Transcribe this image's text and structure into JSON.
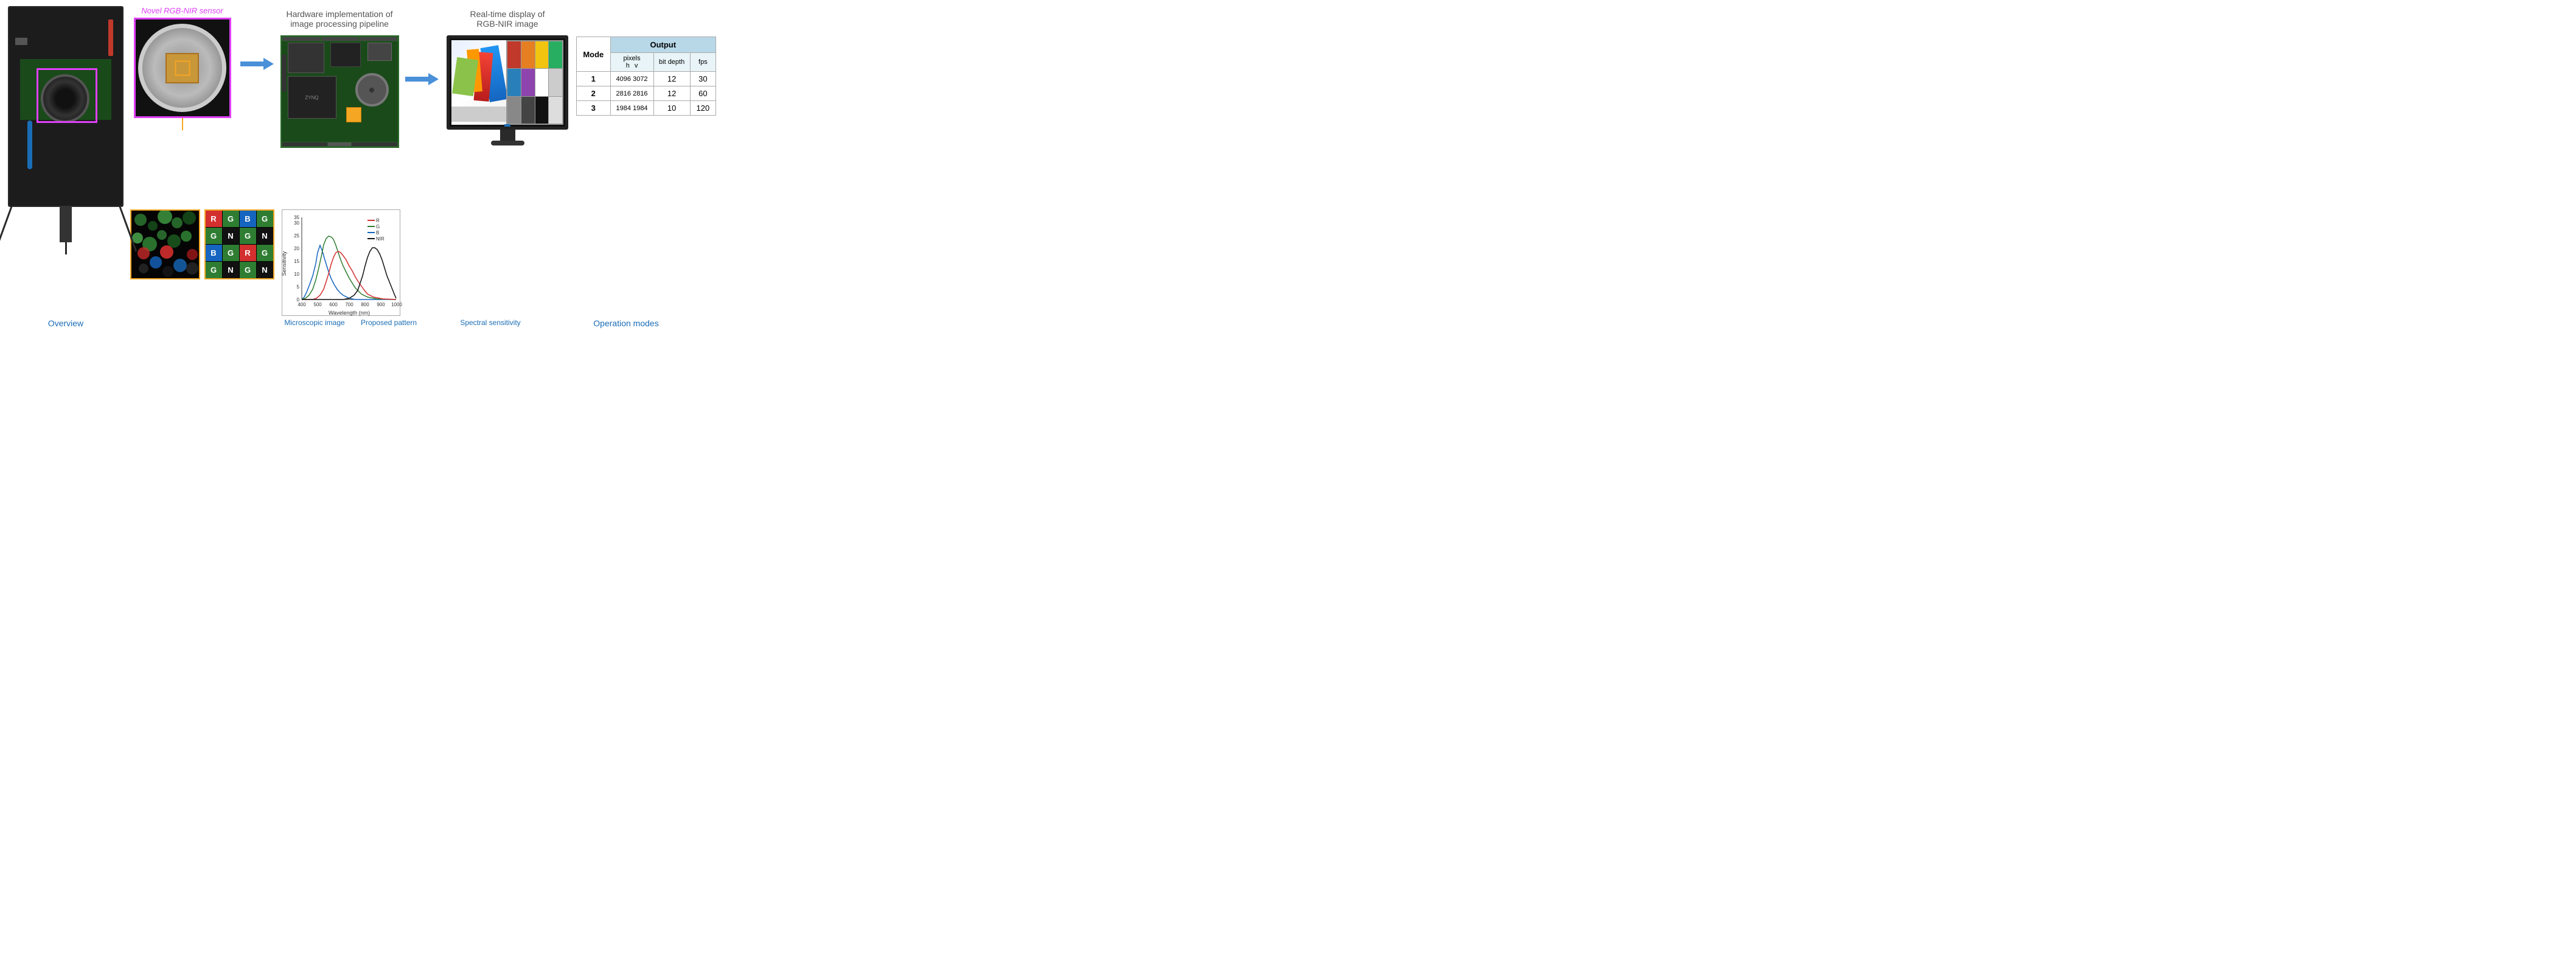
{
  "sections": {
    "overview": {
      "caption": "Overview"
    },
    "sensor": {
      "label": "Novel RGB-NIR sensor"
    },
    "hardware": {
      "title_line1": "Hardware implementation of",
      "title_line2": "image processing pipeline"
    },
    "realtime": {
      "title_line1": "Real-time display of",
      "title_line2": "RGB-NIR image"
    },
    "microscopic": {
      "caption": "Microscopic image"
    },
    "pattern": {
      "caption": "Proposed pattern",
      "cells": [
        {
          "label": "R",
          "color": "#d32f2f"
        },
        {
          "label": "G",
          "color": "#2e7d32"
        },
        {
          "label": "B",
          "color": "#1565c0"
        },
        {
          "label": "G",
          "color": "#2e7d32"
        },
        {
          "label": "G",
          "color": "#2e7d32"
        },
        {
          "label": "N",
          "color": "#111"
        },
        {
          "label": "G",
          "color": "#2e7d32"
        },
        {
          "label": "N",
          "color": "#111"
        },
        {
          "label": "B",
          "color": "#1565c0"
        },
        {
          "label": "G",
          "color": "#2e7d32"
        },
        {
          "label": "R",
          "color": "#d32f2f"
        },
        {
          "label": "G",
          "color": "#2e7d32"
        },
        {
          "label": "G",
          "color": "#2e7d32"
        },
        {
          "label": "N",
          "color": "#111"
        },
        {
          "label": "G",
          "color": "#2e7d32"
        },
        {
          "label": "N",
          "color": "#111"
        }
      ]
    },
    "spectral": {
      "caption": "Spectral sensitivity",
      "x_label": "Wavelength (nm)",
      "y_label": "Sensitivity",
      "x_min": 400,
      "x_max": 1000,
      "y_min": 0,
      "y_max": 35,
      "legend": [
        {
          "label": "R",
          "color": "#d32f2f"
        },
        {
          "label": "G",
          "color": "#2e7d32"
        },
        {
          "label": "B",
          "color": "#1565c0"
        },
        {
          "label": "NIR",
          "color": "#111"
        }
      ],
      "x_ticks": [
        "400",
        "500",
        "600",
        "700",
        "800",
        "900",
        "1000"
      ],
      "y_ticks": [
        "0",
        "5",
        "10",
        "15",
        "20",
        "25",
        "30",
        "35"
      ]
    },
    "operation_modes": {
      "caption": "Operation modes",
      "output_header": "Output",
      "mode_header": "Mode",
      "subheaders": {
        "pixels": "pixels",
        "h": "h",
        "v": "v",
        "bit_depth": "bit depth",
        "fps": "fps"
      },
      "rows": [
        {
          "mode": "1",
          "h": "4096",
          "v": "3072",
          "bit_depth": "12",
          "fps": "30"
        },
        {
          "mode": "2",
          "h": "2816",
          "v": "2816",
          "bit_depth": "12",
          "fps": "60"
        },
        {
          "mode": "3",
          "h": "1984",
          "v": "1984",
          "bit_depth": "10",
          "fps": "120"
        }
      ]
    }
  }
}
